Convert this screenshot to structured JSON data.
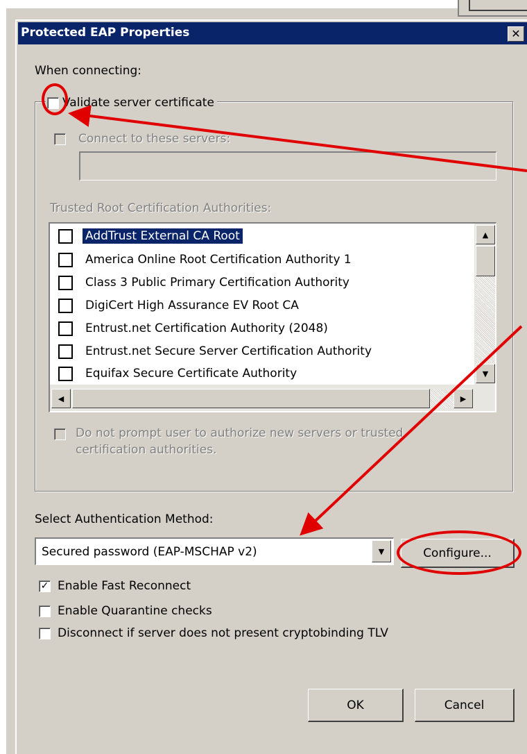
{
  "dialog": {
    "title": "Protected EAP Properties",
    "close_glyph": "✕"
  },
  "when_connecting_label": "When connecting:",
  "validate_cert": {
    "label": "Validate server certificate",
    "checked": false
  },
  "connect_servers": {
    "label": "Connect to these servers:",
    "checked": false,
    "value": ""
  },
  "trusted_root_label": "Trusted Root Certification Authorities:",
  "trusted_roots": [
    {
      "label": "AddTrust External CA Root",
      "selected": true
    },
    {
      "label": "America Online Root Certification Authority 1",
      "selected": false
    },
    {
      "label": "Class 3 Public Primary Certification Authority",
      "selected": false
    },
    {
      "label": "DigiCert High Assurance EV Root CA",
      "selected": false
    },
    {
      "label": "Entrust.net Certification Authority (2048)",
      "selected": false
    },
    {
      "label": "Entrust.net Secure Server Certification Authority",
      "selected": false
    },
    {
      "label": "Equifax Secure Certificate Authority",
      "selected": false
    }
  ],
  "do_not_prompt": {
    "line1": "Do not prompt user to authorize new servers or trusted",
    "line2": "certification authorities.",
    "checked": false
  },
  "auth_method": {
    "label": "Select Authentication Method:",
    "selected": "Secured password (EAP-MSCHAP v2)",
    "configure_label": "Configure..."
  },
  "options": [
    {
      "label": "Enable Fast Reconnect",
      "checked": true
    },
    {
      "label": "Enable Quarantine checks",
      "checked": false
    },
    {
      "label": "Disconnect if server does not present cryptobinding TLV",
      "checked": false
    }
  ],
  "buttons": {
    "ok": "OK",
    "cancel": "Cancel"
  },
  "colors": {
    "titlebar": "#0a246a",
    "face": "#d4d0c8",
    "annotation": "#e00000",
    "selection": "#0a246a"
  }
}
